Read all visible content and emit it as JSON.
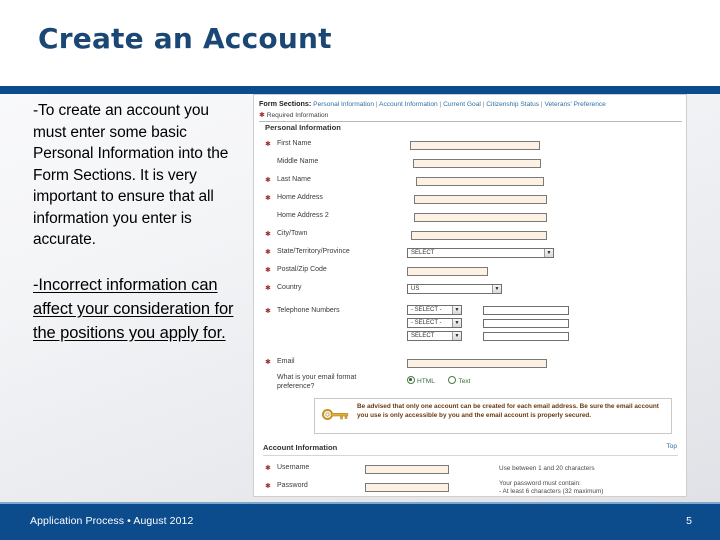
{
  "slide": {
    "title": "Create an Account",
    "accent_color": "#0c4c8d",
    "title_color": "#1b4775",
    "body": {
      "paragraph_1": "-To create an account you must enter some basic Personal Information into the Form Sections.  It is very important to ensure that all information you enter is accurate.",
      "paragraph_2": "-Incorrect information can affect your consideration for the positions you apply for."
    },
    "footer": {
      "text": "Application Process  •  August 2012",
      "page_number": "5"
    }
  },
  "screenshot": {
    "form_sections": {
      "label": "Form Sections:",
      "separator": "|",
      "links": [
        "Personal Information",
        "Account Information",
        "Current Goal",
        "Citizenship Status",
        "Veterans' Preference"
      ]
    },
    "required_note": "Required Information",
    "required_marker": "✱",
    "personal_section_title": "Personal Information",
    "account_section_title": "Account Information",
    "top_link": "Top",
    "personal_fields": [
      {
        "label": "First Name",
        "required": true,
        "control": "text"
      },
      {
        "label": "Middle Name",
        "required": false,
        "control": "text"
      },
      {
        "label": "Last Name",
        "required": true,
        "control": "text"
      },
      {
        "label": "Home Address",
        "required": true,
        "control": "text"
      },
      {
        "label": "Home Address 2",
        "required": false,
        "control": "text"
      },
      {
        "label": "City/Town",
        "required": true,
        "control": "text"
      },
      {
        "label": "State/Territory/Province",
        "required": true,
        "control": "select",
        "value": "SELECT"
      },
      {
        "label": "Postal/Zip Code",
        "required": true,
        "control": "text"
      },
      {
        "label": "Country",
        "required": true,
        "control": "select",
        "value": "US"
      },
      {
        "label": "Telephone Numbers",
        "required": true,
        "control": "phone"
      }
    ],
    "phone_rows": [
      {
        "select_value": "- SELECT -",
        "text_value": ""
      },
      {
        "select_value": "- SELECT -",
        "text_value": ""
      },
      {
        "select_value": "SELECT",
        "text_value": ""
      }
    ],
    "email_field": {
      "label": "Email",
      "required": true,
      "value": ""
    },
    "email_format": {
      "label": "What is your email format preference?",
      "options": [
        {
          "label": "HTML",
          "selected": true
        },
        {
          "label": "Text",
          "selected": false
        }
      ]
    },
    "notice": {
      "icon": "key-icon",
      "text": "Be advised that only one account can be created for each email address. Be sure the email account you use is only accessible by you and the email account is properly secured."
    },
    "account_fields": [
      {
        "label": "Username",
        "required": true,
        "value": "",
        "hint": "Use between 1 and 20 characters"
      },
      {
        "label": "Password",
        "required": true,
        "value": "",
        "hint": "Your password must contain:\n  - At least 6 characters (32 maximum)"
      }
    ]
  }
}
